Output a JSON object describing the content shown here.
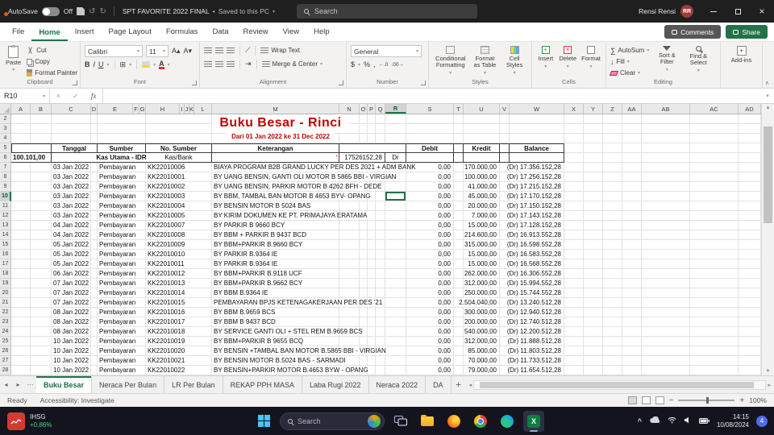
{
  "titlebar": {
    "autosave_label": "AutoSave",
    "autosave_state": "Off",
    "doc_title": "SPT FAVORITE 2022 FINAL",
    "doc_status": "Saved to this PC",
    "search_placeholder": "Search",
    "user_name": "Rensi Rensi",
    "user_initials": "RR"
  },
  "ribbon_tabs": [
    "File",
    "Home",
    "Insert",
    "Page Layout",
    "Formulas",
    "Data",
    "Review",
    "View",
    "Help"
  ],
  "active_ribbon_tab": "Home",
  "ribbon_right": {
    "comments": "Comments",
    "share": "Share"
  },
  "ribbon": {
    "clipboard": {
      "label": "Clipboard",
      "paste": "Paste",
      "cut": "Cut",
      "copy": "Copy",
      "format_painter": "Format Painter"
    },
    "font": {
      "label": "Font",
      "family": "Calibri",
      "size": "11"
    },
    "alignment": {
      "label": "Alignment",
      "wrap": "Wrap Text",
      "merge": "Merge & Center"
    },
    "number": {
      "label": "Number",
      "format": "General"
    },
    "styles": {
      "label": "Styles",
      "cf": "Conditional Formatting",
      "fat": "Format as Table",
      "cs": "Cell Styles"
    },
    "cells": {
      "label": "Cells",
      "insert": "Insert",
      "delete": "Delete",
      "format": "Format"
    },
    "editing": {
      "label": "Editing",
      "autosum": "AutoSum",
      "fill": "Fill",
      "clear": "Clear",
      "sort": "Sort & Filter",
      "find": "Find & Select"
    },
    "addins": {
      "label": "Add-ins"
    }
  },
  "formula_bar": {
    "name_box": "R10"
  },
  "sheet": {
    "columns": [
      "A",
      "B",
      "C",
      "D",
      "E",
      "F",
      "G",
      "H",
      "I",
      "J",
      "K",
      "L",
      "M",
      "N",
      "O",
      "P",
      "Q",
      "R",
      "S",
      "T",
      "U",
      "V",
      "W",
      "X",
      "Y",
      "Z",
      "AA",
      "AB",
      "AC",
      "AD"
    ],
    "selected_col": "R",
    "selected_row": 10,
    "selected_cell": "R10",
    "title": "Buku Besar - Rinci",
    "subtitle": "Dari 01 Jan 2022 ke 31 Dec 2022",
    "header_row": {
      "tanggal": "Tanggal",
      "sumber": "Sumber",
      "no_sumber": "No. Sumber",
      "keterangan": "Keterangan",
      "debit": "Debit",
      "kredit": "Kredit",
      "balance": "Balance"
    },
    "account_row": {
      "code": "100.101,00",
      "name": "Kas Utama - IDR",
      "type": "Kas/Bank",
      "opening": "17526152,28",
      "dr": "Dr"
    },
    "rows": [
      {
        "row": 7,
        "tanggal": "03 Jan 2022",
        "sumber": "Pembayaran",
        "no": "KK22010006",
        "ket": "BIAYA PROGRAM B2B GRAND LUCKY PER DES 2021 + ADM BANK",
        "debit": "0,00",
        "kredit": "170.000,00",
        "balance": "(Dr) 17.356.152,28"
      },
      {
        "row": 8,
        "tanggal": "03 Jan 2022",
        "sumber": "Pembayaran",
        "no": "KK22010001",
        "ket": "BY UANG BENSIN, GANTI OLI MOTOR B 5865 BBI - VIRGIAN",
        "debit": "0,00",
        "kredit": "100.000,00",
        "balance": "(Dr) 17.256.152,28"
      },
      {
        "row": 9,
        "tanggal": "03 Jan 2022",
        "sumber": "Pembayaran",
        "no": "KK22010002",
        "ket": "BY UANG BENSIN, PARKIR MOTOR B 4262 BFH - DEDE",
        "debit": "0,00",
        "kredit": "41.000,00",
        "balance": "(Dr) 17.215.152,28"
      },
      {
        "row": 10,
        "tanggal": "03 Jan 2022",
        "sumber": "Pembayaran",
        "no": "KK22010003",
        "ket": "BY BBM, TAMBAL BAN MOTOR B 4653 BYV- OPANG",
        "debit": "0,00",
        "kredit": "45.000,00",
        "balance": "(Dr) 17.170.152,28"
      },
      {
        "row": 11,
        "tanggal": "03 Jan 2022",
        "sumber": "Pembayaran",
        "no": "KK22010004",
        "ket": "BY BENSIN MOTOR B 5024 BAS",
        "debit": "0,00",
        "kredit": "20.000,00",
        "balance": "(Dr) 17.150.152,28"
      },
      {
        "row": 12,
        "tanggal": "03 Jan 2022",
        "sumber": "Pembayaran",
        "no": "KK22010005",
        "ket": "BY KIRIM DOKUMEN KE PT. PRIMAJAYA ERATAMA",
        "debit": "0,00",
        "kredit": "7.000,00",
        "balance": "(Dr) 17.143.152,28"
      },
      {
        "row": 13,
        "tanggal": "04 Jan 2022",
        "sumber": "Pembayaran",
        "no": "KK22010007",
        "ket": "BY PARKIR B 9660 BCY",
        "debit": "0,00",
        "kredit": "15.000,00",
        "balance": "(Dr) 17.128.152,28"
      },
      {
        "row": 14,
        "tanggal": "04 Jan 2022",
        "sumber": "Pembayaran",
        "no": "KK22010008",
        "ket": "BY BBM + PARKIR B 9437 BCD",
        "debit": "0,00",
        "kredit": "214.600,00",
        "balance": "(Dr) 16.913.552,28"
      },
      {
        "row": 15,
        "tanggal": "05 Jan 2022",
        "sumber": "Pembayaran",
        "no": "KK22010009",
        "ket": "BY BBM+PARKIR B.9660 BCY",
        "debit": "0,00",
        "kredit": "315.000,00",
        "balance": "(Dr) 16.598.552,28"
      },
      {
        "row": 16,
        "tanggal": "05 Jan 2022",
        "sumber": "Pembayaran",
        "no": "KK22010010",
        "ket": "BY PARKIR B.9364 IE",
        "debit": "0,00",
        "kredit": "15.000,00",
        "balance": "(Dr) 16.583.552,28"
      },
      {
        "row": 17,
        "tanggal": "05 Jan 2022",
        "sumber": "Pembayaran",
        "no": "KK22010011",
        "ket": "BY PARKIR B.9364 IE",
        "debit": "0,00",
        "kredit": "15.000,00",
        "balance": "(Dr) 16.568.552,28"
      },
      {
        "row": 18,
        "tanggal": "06 Jan 2022",
        "sumber": "Pembayaran",
        "no": "KK22010012",
        "ket": "BY BBM+PARKIR B.9118 UCF",
        "debit": "0,00",
        "kredit": "262.000,00",
        "balance": "(Dr) 16.306.552,28"
      },
      {
        "row": 19,
        "tanggal": "07 Jan 2022",
        "sumber": "Pembayaran",
        "no": "KK22010013",
        "ket": "BY BBM+PARKIR B.9662 BCY",
        "debit": "0,00",
        "kredit": "312.000,00",
        "balance": "(Dr) 15.994.552,28"
      },
      {
        "row": 20,
        "tanggal": "07 Jan 2022",
        "sumber": "Pembayaran",
        "no": "KK22010014",
        "ket": "BY BBM B.9364 IE",
        "debit": "0,00",
        "kredit": "250.000,00",
        "balance": "(Dr) 15.744.552,28"
      },
      {
        "row": 21,
        "tanggal": "07 Jan 2022",
        "sumber": "Pembayaran",
        "no": "KK22010015",
        "ket": "PEMBAYARAN BPJS KETENAGAKERJAAN PER DES '21",
        "debit": "0,00",
        "kredit": "2.504.040,00",
        "balance": "(Dr) 13.240.512,28"
      },
      {
        "row": 22,
        "tanggal": "08 Jan 2022",
        "sumber": "Pembayaran",
        "no": "KK22010016",
        "ket": "BY BBM B.9659 BCS",
        "debit": "0,00",
        "kredit": "300.000,00",
        "balance": "(Dr) 12.940.512,28"
      },
      {
        "row": 23,
        "tanggal": "08 Jan 2022",
        "sumber": "Pembayaran",
        "no": "KK22010017",
        "ket": "BY BBM B 9437 BCD",
        "debit": "0,00",
        "kredit": "200.000,00",
        "balance": "(Dr) 12.740.512,28"
      },
      {
        "row": 24,
        "tanggal": "08 Jan 2022",
        "sumber": "Pembayaran",
        "no": "KK22010018",
        "ket": "BY SERVICE GANTI OLI + STEL REM B.9659 BCS",
        "debit": "0,00",
        "kredit": "540.000,00",
        "balance": "(Dr) 12.200.512,28"
      },
      {
        "row": 25,
        "tanggal": "10 Jan 2022",
        "sumber": "Pembayaran",
        "no": "KK22010019",
        "ket": "BY BBM+PARKIR B 9655 BCQ",
        "debit": "0,00",
        "kredit": "312.000,00",
        "balance": "(Dr) 11.888.512,28"
      },
      {
        "row": 26,
        "tanggal": "10 Jan 2022",
        "sumber": "Pembayaran",
        "no": "KK22010020",
        "ket": "BY BENSIN +TAMBAL BAN MOTOR B.5865 BBI - VIRGIAN",
        "debit": "0,00",
        "kredit": "85.000,00",
        "balance": "(Dr) 11.803.512,28"
      },
      {
        "row": 27,
        "tanggal": "10 Jan 2022",
        "sumber": "Pembayaran",
        "no": "KK22010021",
        "ket": "BY BENSIN MOTOR B.5024 BAS - SARMADI",
        "debit": "0,00",
        "kredit": "70.000,00",
        "balance": "(Dr) 11.733.512,28"
      },
      {
        "row": 28,
        "tanggal": "10 Jan 2022",
        "sumber": "Pembayaran",
        "no": "KK22010022",
        "ket": "BY BENSIN+PARKIR MOTOR B.4653 BYW - OPANG",
        "debit": "0,00",
        "kredit": "79.000,00",
        "balance": "(Dr) 11.654.512,28"
      }
    ]
  },
  "sheet_tabs": {
    "tabs": [
      {
        "label": "Buku Besar",
        "active": true
      },
      {
        "label": "Neraca Per Bulan"
      },
      {
        "label": "LR Per Bulan"
      },
      {
        "label": "REKAP PPH MASA"
      },
      {
        "label": "Laba Rugi 2022"
      },
      {
        "label": "Neraca 2022"
      },
      {
        "label": "DA"
      }
    ],
    "add_label": "+"
  },
  "status_bar": {
    "ready": "Ready",
    "accessibility": "Accessibility: Investigate",
    "zoom": "100%"
  },
  "taskbar": {
    "ticker": "IHSG",
    "ticker_change": "+0,86%",
    "search_placeholder": "Search",
    "time": "14:15",
    "date": "10/08/2024",
    "notification_count": "4"
  }
}
